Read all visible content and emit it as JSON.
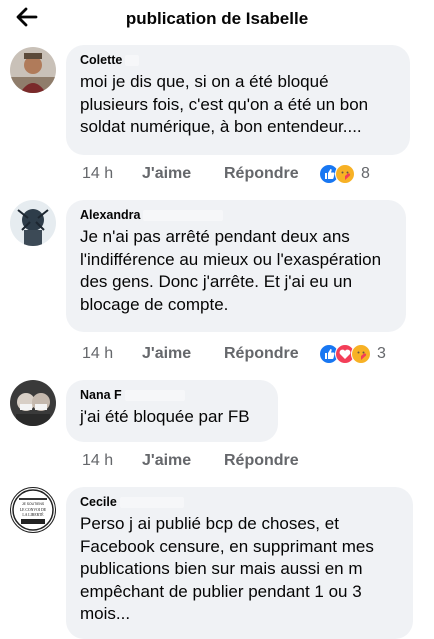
{
  "header": {
    "title": "publication de Isabelle"
  },
  "comments": [
    {
      "author": "Colette",
      "text": "moi je dis que, si on a été bloqué plusieurs fois, c'est qu'on a été un bon soldat numérique, à bon entendeur....",
      "time": "14 h",
      "like": "J'aime",
      "reply": "Répondre",
      "reactions": [
        "like-icon",
        "care-icon"
      ],
      "count": "8"
    },
    {
      "author": "Alexandra",
      "text": "Je n'ai pas arrêté pendant deux ans l'indifférence au mieux ou l'exaspération des gens. Donc j'arrête. Et j'ai eu un blocage de compte.",
      "time": "14 h",
      "like": "J'aime",
      "reply": "Répondre",
      "reactions": [
        "like-icon",
        "love-icon",
        "care-icon"
      ],
      "count": "3"
    },
    {
      "author": "Nana F",
      "text": "j'ai été bloquée par FB",
      "time": "14 h",
      "like": "J'aime",
      "reply": "Répondre"
    },
    {
      "author": "Cecile",
      "text": "Perso j ai publié bcp de choses, et Facebook censure, en supprimant mes publications bien sur mais aussi en m empêchant de publier pendant 1 ou 3 mois...",
      "avatar_text": [
        "JE SOUTIENS",
        "LE CONVOI DE",
        "LA LIBERTÉ"
      ]
    }
  ],
  "colors": {
    "bubble": "#f0f2f5",
    "like": "#1877f2",
    "love": "#f33e58",
    "care": "#f7b125",
    "meta": "#65676b"
  }
}
